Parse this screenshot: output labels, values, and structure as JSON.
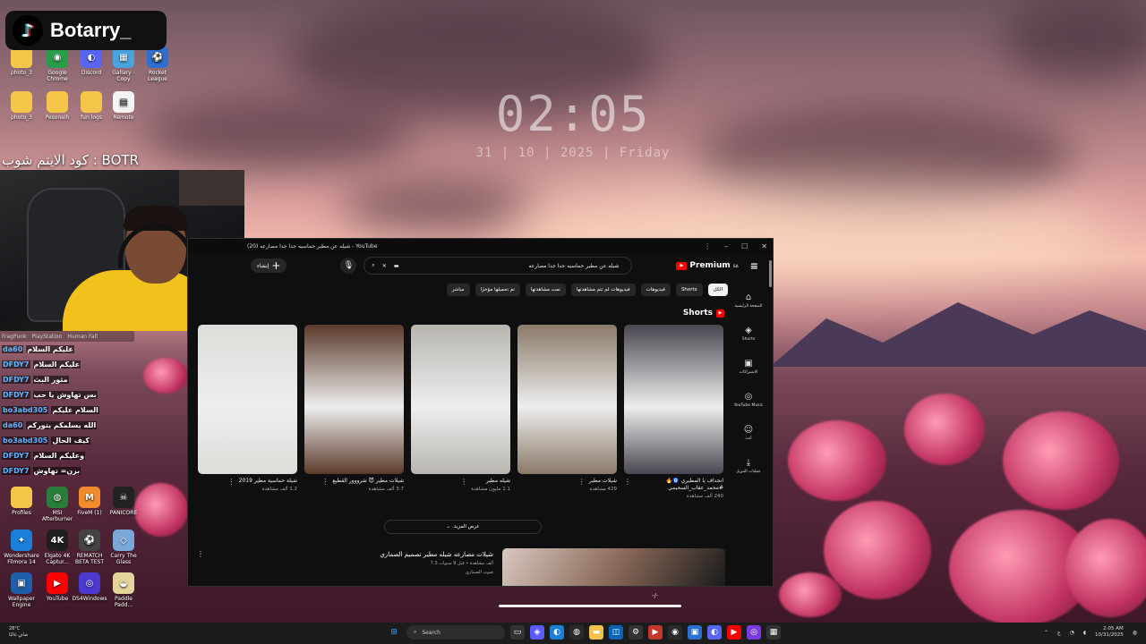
{
  "overlay": {
    "channel_name": "Botarry_",
    "caption": "كود الايتم شوب : BOTR"
  },
  "clock": {
    "time": "02:05",
    "date": "31  |  10  |  2025  |  Friday"
  },
  "desktop_icons": [
    {
      "label": "photo_3",
      "kind": "folder"
    },
    {
      "label": "Google Chrome",
      "kind": "app",
      "color": "#2a9d4a",
      "glyph": "◉"
    },
    {
      "label": "Discord",
      "kind": "app",
      "color": "#5865f2",
      "glyph": "◐"
    },
    {
      "label": "Gallary - Copy",
      "kind": "app",
      "color": "#4aa3df",
      "glyph": "▦"
    },
    {
      "label": "Rocket League",
      "kind": "app",
      "color": "#2f6fd0",
      "glyph": "⚽"
    },
    {
      "label": "photo_3",
      "kind": "folder"
    },
    {
      "label": "Pesonalh",
      "kind": "folder"
    },
    {
      "label": "fun logs",
      "kind": "folder"
    },
    {
      "label": "Remote",
      "kind": "file"
    },
    {
      "label": "Profiles",
      "kind": "folder"
    },
    {
      "label": "MSI Afterburner",
      "kind": "app",
      "color": "#2a7d3a",
      "glyph": "◍"
    },
    {
      "label": "FiveM (1)",
      "kind": "app",
      "color": "#f28b2b",
      "glyph": "M"
    },
    {
      "label": "PANICORE",
      "kind": "app",
      "color": "#222",
      "glyph": "☠"
    },
    {
      "label": "Wondershare Filmora 14",
      "kind": "app",
      "color": "#1a7fd6",
      "glyph": "✦"
    },
    {
      "label": "Elgato 4K Captur...",
      "kind": "app",
      "color": "#1f1f1f",
      "glyph": "4K"
    },
    {
      "label": "REMATCH BETA TEST",
      "kind": "app",
      "color": "#444",
      "glyph": "⚽"
    },
    {
      "label": "Carry The Glass",
      "kind": "app",
      "color": "#79a8d8",
      "glyph": "◇"
    },
    {
      "label": "Wallpaper Engine",
      "kind": "app",
      "color": "#1f5fa8",
      "glyph": "▣"
    },
    {
      "label": "YouTube",
      "kind": "app",
      "color": "#ff0000",
      "glyph": "▶"
    },
    {
      "label": "DS4Windows",
      "kind": "app",
      "color": "#4a3ad0",
      "glyph": "◎"
    },
    {
      "label": "Paddle Padd...",
      "kind": "app",
      "color": "#e3d49a",
      "glyph": "◒"
    }
  ],
  "chat": {
    "tabs": [
      "FragPunk",
      "PlayStation",
      "Human Fall"
    ],
    "messages": [
      {
        "user": "da60",
        "text": "عليكم السلام"
      },
      {
        "user": "DFDY7",
        "text": "عليكم السلام"
      },
      {
        "user": "DFDY7",
        "text": "مثور البث"
      },
      {
        "user": "DFDY7",
        "text": "بس تهاوش يا حب"
      },
      {
        "user": "bo3abd305",
        "text": "السلام عليكم"
      },
      {
        "user": "da60",
        "text": "الله يسلمكم يتوركم"
      },
      {
        "user": "bo3abd305",
        "text": "كيف الحال"
      },
      {
        "user": "DFDY7",
        "text": "وعليكم السلام"
      },
      {
        "user": "DFDY7",
        "text": "بزن= تهاوش"
      }
    ]
  },
  "youtube": {
    "window_title": "شيله عن مطير حماسيه جدا جدا مصارعه (20) - YouTube",
    "create_label": "إنشاء",
    "search_query": "شيله عن مطير حماسيه جدا جدا مصارعه",
    "brand": "Premium",
    "brand_sup": "SA",
    "chips": [
      "الكل",
      "Shorts",
      "فيديوهات",
      "فيديوهات لم تتم مشاهدتها",
      "تمت مشاهدتها",
      "تم تحميلها مؤخرًا",
      "مباشر"
    ],
    "sidebar": [
      "الصفحة الرئيسية",
      "Shorts",
      "الاشتراكات",
      "YouTube Music",
      "أنت",
      "عمليات التنزيل"
    ],
    "shorts_heading": "Shorts",
    "shorts": [
      {
        "title": "شيلة حماسية مطير 2019",
        "views": "1.2 ألف مشاهدة",
        "tone": "#dcdcd8"
      },
      {
        "title": "شيلات مطير 😈 شرووور القطيع",
        "views": "3.7 ألف مشاهدة",
        "tone": "#5a3a2a"
      },
      {
        "title": "شيله مطير",
        "views": "1.1 مليون مشاهدة",
        "tone": "#b8b5b0"
      },
      {
        "title": "شيلات مطير",
        "views": "429 مشاهدة",
        "tone": "#8a7a68"
      },
      {
        "title": "انحداف يا المطيري 🧿🔥 #محمد_عقاب_السحيمي",
        "views": "240 ألف مشاهدة",
        "tone": "#4a4650"
      }
    ],
    "show_more": "عرض المزيد",
    "video": {
      "title": "شيلات مصارعه شيله مطير تصميم الصماري",
      "meta": "7.3 ألف مشاهدة • قبل 9 سنوات",
      "channel": "صوت الصماري"
    }
  },
  "taskbar": {
    "weather_temp": "28°C",
    "weather_text": "صافٍ غالبًا",
    "search_placeholder": "Search",
    "time": "2:05 AM",
    "date": "10/31/2025",
    "lang": "ع"
  }
}
